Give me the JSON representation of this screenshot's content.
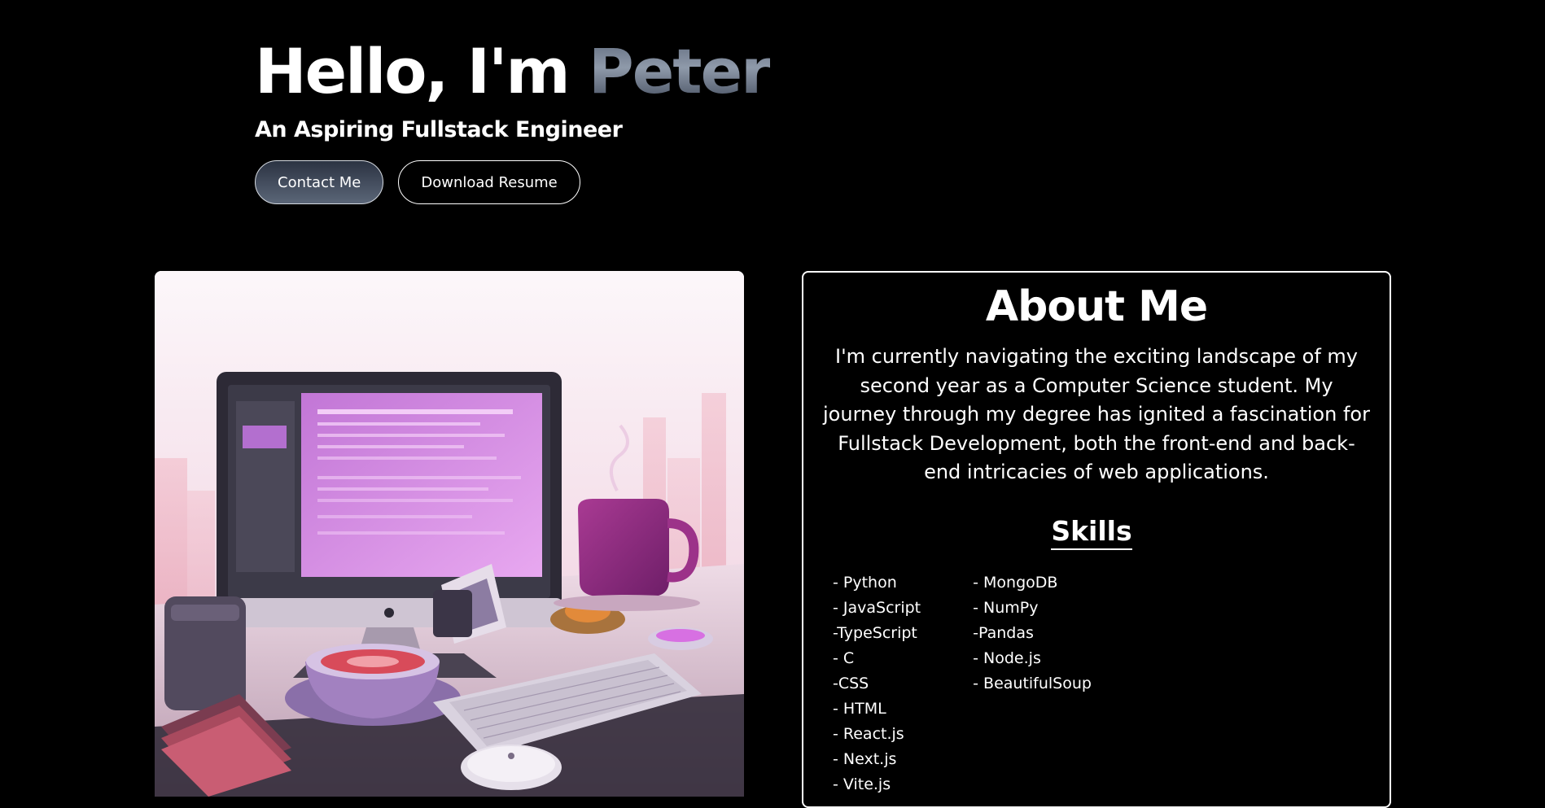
{
  "hero": {
    "greeting": "Hello, I'm ",
    "name": "Peter",
    "subtitle": "An Aspiring Fullstack Engineer",
    "contact_label": "Contact Me",
    "resume_label": "Download Resume"
  },
  "about": {
    "title": "About Me",
    "text": "I'm currently navigating the exciting landscape of my second year as a Computer Science student. My journey through my degree has ignited a fascination for Fullstack Development, both the front-end and back-end intricacies of web applications.",
    "skills_title": "Skills",
    "skills_col1": [
      "- Python",
      "- JavaScript",
      "-TypeScript",
      "- C",
      "-CSS",
      "- HTML",
      "- React.js",
      "- Next.js",
      "- Vite.js"
    ],
    "skills_col2": [
      "- MongoDB",
      "- NumPy",
      "-Pandas",
      "- Node.js",
      "- BeautifulSoup"
    ]
  },
  "theme": {
    "background": "#000000",
    "text": "#ffffff",
    "accent_gradient": [
      "#5b6679",
      "#8f9aaa"
    ]
  }
}
